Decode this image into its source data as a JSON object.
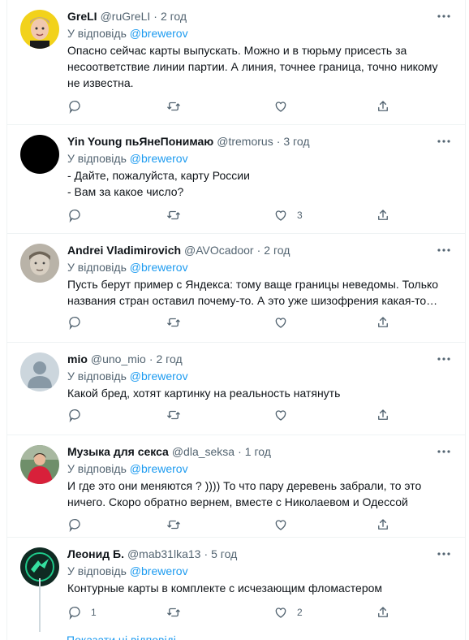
{
  "reply_prefix": "У відповідь",
  "tweets": [
    {
      "name": "GreLI",
      "handle": "@ruGreLI",
      "time": "2 год",
      "reply_to": "@brewerov",
      "lines": [
        "Опасно сейчас карты выпускать. Можно и в тюрьму присесть за",
        "несоответствие линии партии. А линия, точнее граница, точно никому",
        "не известна."
      ],
      "reply_count": "",
      "retweet_count": "",
      "like_count": ""
    },
    {
      "name": "Yin Young пьЯнеПонимаю",
      "handle": "@tremorus",
      "time": "3 год",
      "reply_to": "@brewerov",
      "lines": [
        "- Дайте, пожалуйста, карту России",
        "- Вам за какое число?"
      ],
      "reply_count": "",
      "retweet_count": "",
      "like_count": "3"
    },
    {
      "name": "Andrei Vladimirovich",
      "handle": "@AVOcadoor",
      "time": "2 год",
      "reply_to": "@brewerov",
      "lines": [
        "Пусть берут пример с Яндекса: тому ваще границы неведомы.  Только",
        "названия стран оставил почему-то. А это уже шизофрения какая-то…"
      ],
      "reply_count": "",
      "retweet_count": "",
      "like_count": ""
    },
    {
      "name": "mio",
      "handle": "@uno_mio",
      "time": "2 год",
      "reply_to": "@brewerov",
      "lines": [
        "Какой бред, хотят картинку на реальность натянуть"
      ],
      "reply_count": "",
      "retweet_count": "",
      "like_count": ""
    },
    {
      "name": "Музыка для секса",
      "handle": "@dla_seksa",
      "time": "1 год",
      "reply_to": "@brewerov",
      "lines": [
        "И где это они меняются ? )))) То что пару деревень забрали, то это",
        "ничего. Скоро обратно вернем, вместе с Николаевом и Одессой"
      ],
      "reply_count": "",
      "retweet_count": "",
      "like_count": ""
    },
    {
      "name": "Леонид Б.",
      "handle": "@mab31lka13",
      "time": "5 год",
      "reply_to": "@brewerov",
      "lines": [
        "Контурные карты в комплекте с исчезающим фломастером"
      ],
      "reply_count": "1",
      "retweet_count": "",
      "like_count": "2"
    }
  ],
  "show_more": "Показати ці відповіді",
  "colors": {
    "accent": "#1d9bf0",
    "secondary_text": "#536471",
    "text": "#0f1419"
  }
}
